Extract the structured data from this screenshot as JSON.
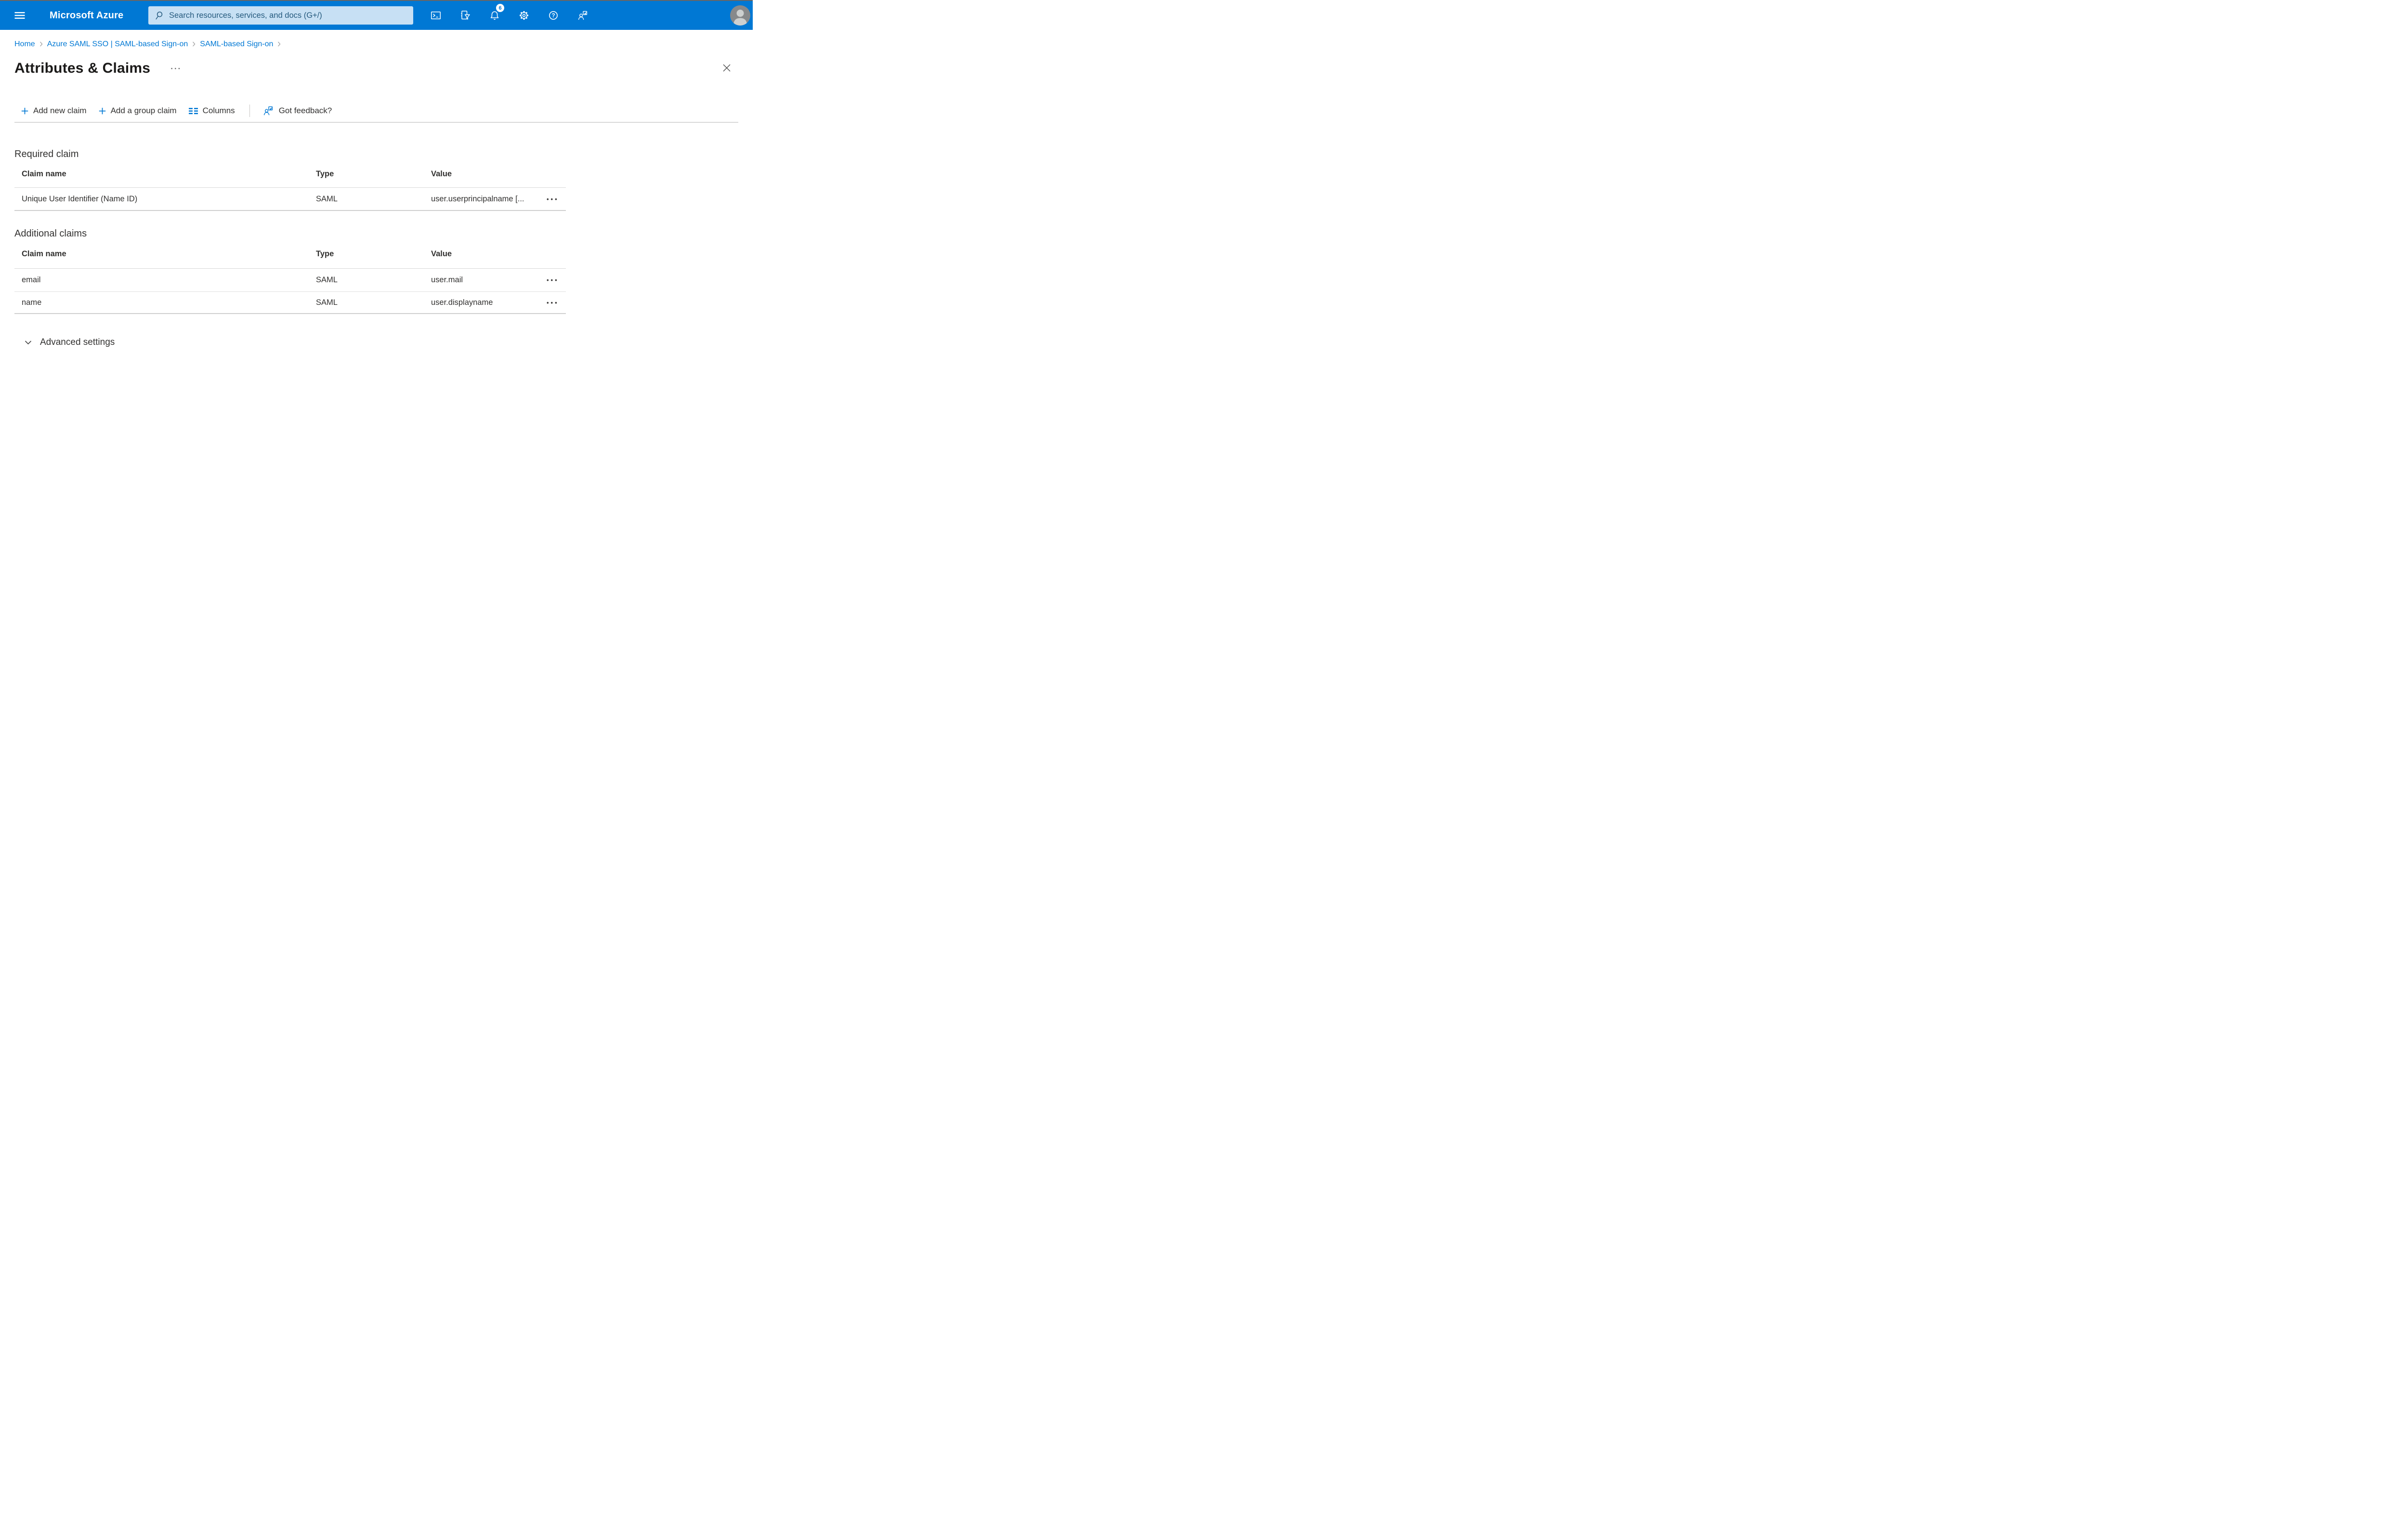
{
  "topbar": {
    "brand": "Microsoft Azure",
    "search": {
      "placeholder": "Search resources, services, and docs (G+/)"
    },
    "notification_badge": "6",
    "icons": [
      "hamburger-menu-icon",
      "search-icon",
      "cloud-shell-icon",
      "directory-filter-icon",
      "notifications-bell-icon",
      "settings-gear-icon",
      "help-icon",
      "feedback-icon",
      "user-avatar"
    ]
  },
  "breadcrumb": {
    "items": [
      "Home",
      "Azure SAML SSO | SAML-based Sign-on",
      "SAML-based Sign-on"
    ]
  },
  "page": {
    "title": "Attributes & Claims"
  },
  "ui": {
    "title_overflow_dots": "···",
    "row_menu_dots": "•••"
  },
  "toolbar": {
    "add_new_claim_label": "Add new claim",
    "add_group_claim_label": "Add a group claim",
    "columns_label": "Columns",
    "feedback_label": "Got feedback?"
  },
  "required_claim": {
    "heading": "Required claim",
    "columns": [
      "Claim name",
      "Type",
      "Value"
    ],
    "rows": [
      {
        "claim_name": "Unique User Identifier (Name ID)",
        "type": "SAML",
        "value": "user.userprincipalname [..."
      }
    ]
  },
  "additional_claims": {
    "heading": "Additional claims",
    "columns": [
      "Claim name",
      "Type",
      "Value"
    ],
    "rows": [
      {
        "claim_name": "email",
        "type": "SAML",
        "value": "user.mail"
      },
      {
        "claim_name": "name",
        "type": "SAML",
        "value": "user.displayname"
      }
    ]
  },
  "advanced_settings": {
    "label": "Advanced settings"
  },
  "colors": {
    "topbar_blue": "#0078d4",
    "search_bg": "#c7e0f4",
    "search_text": "#255a7e",
    "link_blue": "#0078d4",
    "text": "#323130",
    "divider": "#d9d9d9"
  }
}
